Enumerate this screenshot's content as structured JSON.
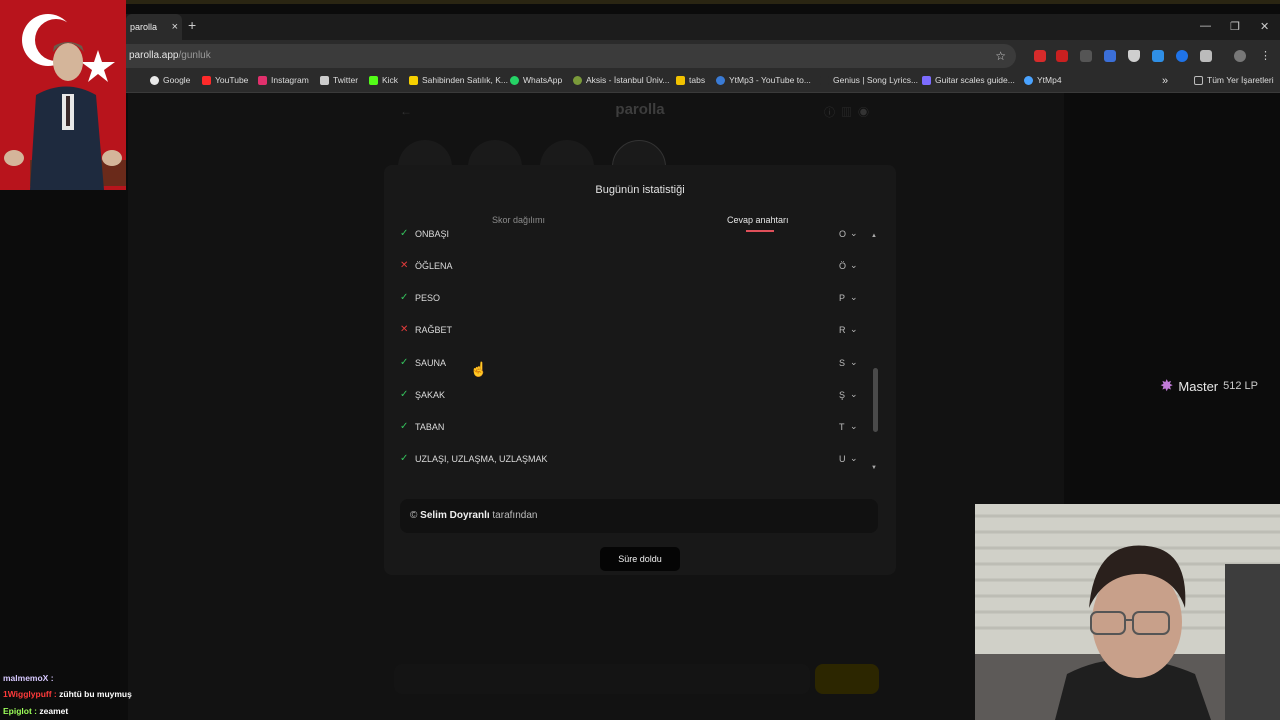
{
  "browser": {
    "tab_title": "parolla",
    "tab_close": "×",
    "new_tab": "+",
    "address_host": "parolla.app",
    "address_path": "/gunluk",
    "bookmarks": [
      {
        "label": "Google",
        "color": "#e9e9e9"
      },
      {
        "label": "YouTube",
        "color": "#ff2a2a"
      },
      {
        "label": "Instagram",
        "color": "#e1306c"
      },
      {
        "label": "Twitter",
        "color": "#cccccc"
      },
      {
        "label": "Kick",
        "color": "#53fc18"
      },
      {
        "label": "Sahibinden Satılık, K...",
        "color": "#f6d000"
      },
      {
        "label": "WhatsApp",
        "color": "#25d366"
      },
      {
        "label": "Aksis - İstanbul Üniv...",
        "color": "#7a9a3a"
      },
      {
        "label": "tabs",
        "color": "#f2c200"
      },
      {
        "label": "YtMp3 - YouTube to...",
        "color": "#3a7bd5"
      },
      {
        "label": "Genius | Song Lyrics...",
        "color": "#2b2b2b"
      },
      {
        "label": "Guitar scales guide...",
        "color": "#7c6cff"
      },
      {
        "label": "YtMp4",
        "color": "#4aa3ff"
      }
    ],
    "all_bookmarks": "Tüm Yer İşaretleri",
    "more": "»"
  },
  "page": {
    "title": "parolla"
  },
  "modal": {
    "title": "Bugünün istatistiği",
    "tabs": [
      "Skor dağılımı",
      "Cevap anahtarı"
    ],
    "active_tab": "Cevap anahtarı",
    "answers": [
      {
        "word": "ONBAŞI",
        "letter": "O",
        "correct": true
      },
      {
        "word": "ÖĞLENA",
        "letter": "Ö",
        "correct": false
      },
      {
        "word": "PESO",
        "letter": "P",
        "correct": true
      },
      {
        "word": "RAĞBET",
        "letter": "R",
        "correct": false
      },
      {
        "word": "SAUNA",
        "letter": "S",
        "correct": true
      },
      {
        "word": "ŞAKAK",
        "letter": "Ş",
        "correct": true
      },
      {
        "word": "TABAN",
        "letter": "T",
        "correct": true
      },
      {
        "word": "UZLAŞI, UZLAŞMA, UZLAŞMAK",
        "letter": "U",
        "correct": true
      }
    ],
    "credit_name": "Selim Doyranlı",
    "credit_suffix": "tarafından",
    "credit_symbol": "©",
    "done_button": "Süre doldu"
  },
  "overlay": {
    "rank": "Master",
    "lp": "512 LP",
    "chat": [
      {
        "user": "malmemoX :",
        "msg": ""
      },
      {
        "user": "1Wigglypuff :",
        "msg": "zühtü bu muymuş"
      },
      {
        "user": "Epiglot :",
        "msg": "zeamet"
      }
    ]
  }
}
